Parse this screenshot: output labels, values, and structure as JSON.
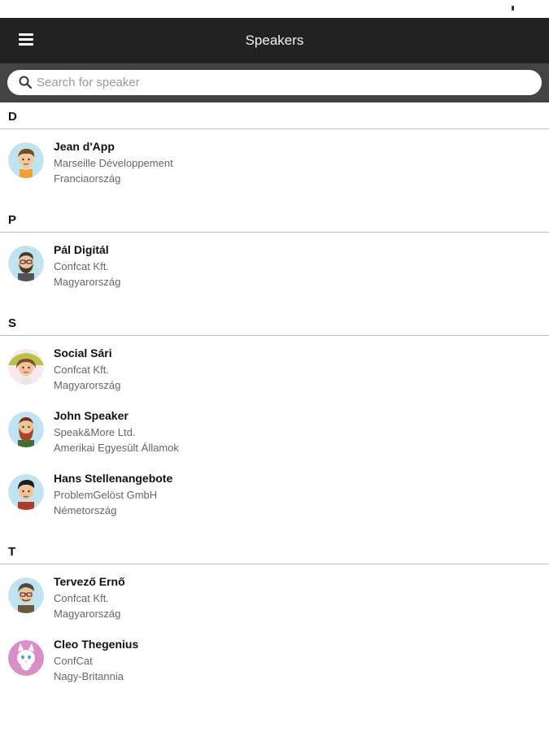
{
  "app": {
    "title": "Speakers"
  },
  "search": {
    "placeholder": "Search for speaker",
    "value": ""
  },
  "sections": [
    {
      "letter": "D",
      "speakers": [
        {
          "name": "Jean d'App",
          "company": "Marseille Développement",
          "country": "Franciaország",
          "avatar": "avatar-boy-icon"
        }
      ]
    },
    {
      "letter": "P",
      "speakers": [
        {
          "name": "Pál Digitál",
          "company": "Confcat Kft.",
          "country": "Magyarország",
          "avatar": "avatar-bearded-glasses-icon"
        }
      ]
    },
    {
      "letter": "S",
      "speakers": [
        {
          "name": "Social Sári",
          "company": "Confcat Kft.",
          "country": "Magyarország",
          "avatar": "avatar-woman-hat-icon"
        },
        {
          "name": "John  Speaker",
          "company": "Speak&More Ltd.",
          "country": "Amerikai Egyesült Államok",
          "avatar": "avatar-red-beard-icon"
        },
        {
          "name": "Hans Stellenangebote",
          "company": "ProblemGelöst GmbH",
          "country": "Németország",
          "avatar": "avatar-man-dark-hair-icon"
        }
      ]
    },
    {
      "letter": "T",
      "speakers": [
        {
          "name": "Tervező Ernő",
          "company": "Confcat Kft.",
          "country": "Magyarország",
          "avatar": "avatar-glasses-man-icon"
        },
        {
          "name": "Cleo Thegenius",
          "company": "ConfCat",
          "country": "Nagy-Britannia",
          "avatar": "avatar-cat-icon"
        }
      ]
    }
  ],
  "colors": {
    "appbar": "#222222",
    "searchbar": "#444444",
    "divider": "#bdbdbd"
  }
}
